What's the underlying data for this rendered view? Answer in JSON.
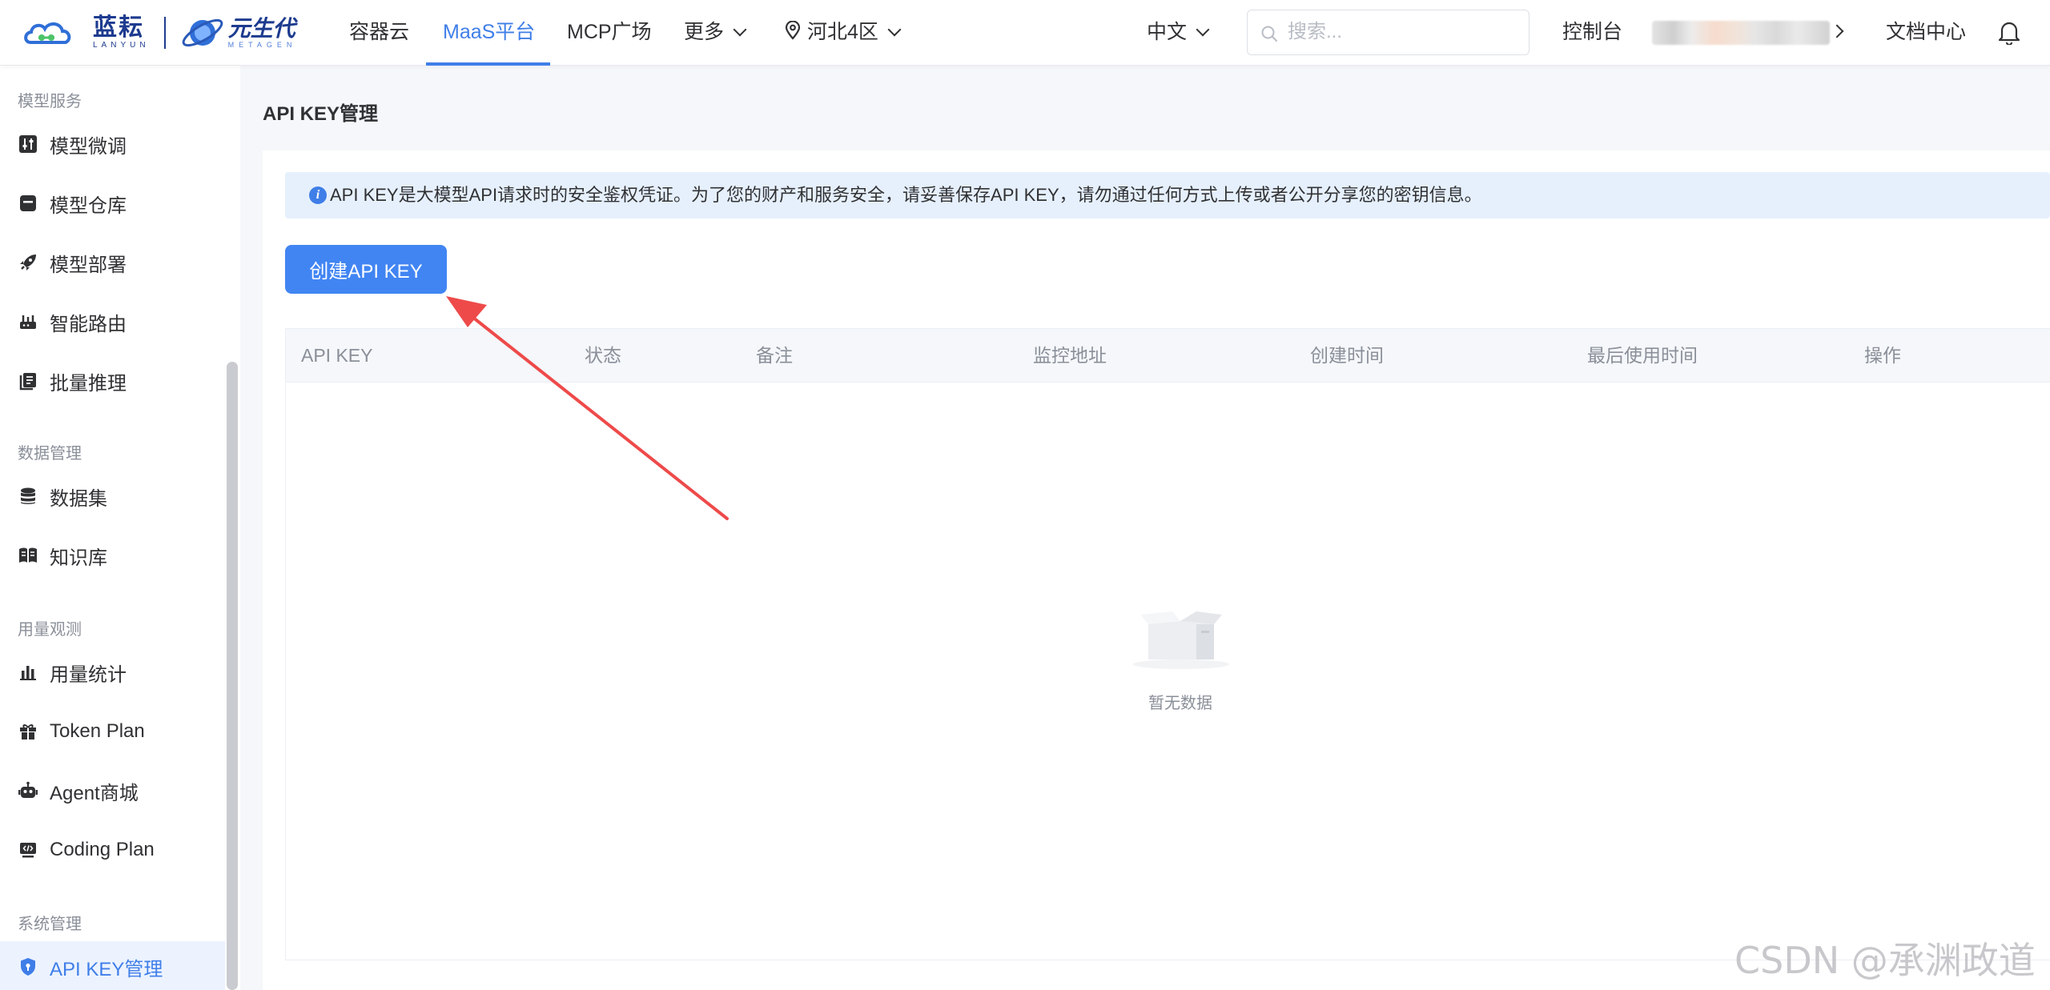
{
  "topnav": {
    "logo1": {
      "name_cn": "蓝耘",
      "name_en": "LANYUN"
    },
    "logo2": {
      "name_cn": "元生代",
      "name_en": "METAGEN"
    },
    "items": [
      {
        "label": "容器云"
      },
      {
        "label": "MaaS平台",
        "active": true
      },
      {
        "label": "MCP广场"
      },
      {
        "label": "更多"
      }
    ],
    "region": "河北4区",
    "language": "中文",
    "search_placeholder": "搜索...",
    "console": "控制台",
    "docs": "文档中心"
  },
  "sidebar": {
    "groups": [
      {
        "title": "模型服务",
        "items": [
          {
            "label": "模型微调",
            "icon": "sliders-icon"
          },
          {
            "label": "模型仓库",
            "icon": "box-icon"
          },
          {
            "label": "模型部署",
            "icon": "rocket-icon"
          },
          {
            "label": "智能路由",
            "icon": "router-icon"
          },
          {
            "label": "批量推理",
            "icon": "book-list-icon"
          }
        ]
      },
      {
        "title": "数据管理",
        "items": [
          {
            "label": "数据集",
            "icon": "database-icon"
          },
          {
            "label": "知识库",
            "icon": "open-book-icon"
          }
        ]
      },
      {
        "title": "用量观测",
        "items": [
          {
            "label": "用量统计",
            "icon": "bar-chart-icon"
          },
          {
            "label": "Token Plan",
            "icon": "gift-icon"
          },
          {
            "label": "Agent商城",
            "icon": "robot-icon"
          },
          {
            "label": "Coding Plan",
            "icon": "code-monitor-icon"
          }
        ]
      },
      {
        "title": "系统管理",
        "items": [
          {
            "label": "API KEY管理",
            "icon": "shield-icon",
            "active": true
          }
        ]
      }
    ]
  },
  "main": {
    "title": "API KEY管理",
    "notice": "API KEY是大模型API请求时的安全鉴权凭证。为了您的财产和服务安全，请妥善保存API KEY，请勿通过任何方式上传或者公开分享您的密钥信息。",
    "create_button": "创建API KEY",
    "table": {
      "columns": [
        "API KEY",
        "状态",
        "备注",
        "监控地址",
        "创建时间",
        "最后使用时间",
        "操作"
      ],
      "rows": [],
      "empty_text": "暂无数据"
    }
  },
  "watermark": "CSDN @承渊政道",
  "colors": {
    "accent": "#3f7ee8",
    "button": "#4185f3",
    "annotation_arrow": "#ee4a4a"
  }
}
